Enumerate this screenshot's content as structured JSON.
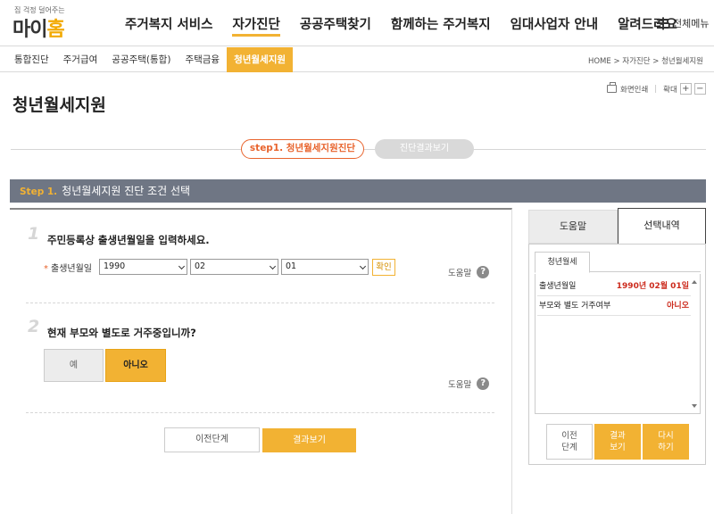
{
  "header": {
    "logo": {
      "tagline": "집 걱정 덜어주는",
      "name_part1": "마이",
      "name_part2": "홈"
    },
    "nav": [
      {
        "label": "주거복지 서비스"
      },
      {
        "label": "자가진단",
        "active": true
      },
      {
        "label": "공공주택찾기"
      },
      {
        "label": "함께하는 주거복지"
      },
      {
        "label": "임대사업자 안내"
      },
      {
        "label": "알려드려요"
      }
    ],
    "all_menu_label": "전체메뉴"
  },
  "subnav": {
    "tabs": [
      {
        "label": "통합진단"
      },
      {
        "label": "주거급여"
      },
      {
        "label": "공공주택(통합)"
      },
      {
        "label": "주택금융"
      },
      {
        "label": "청년월세지원",
        "active": true
      }
    ],
    "breadcrumb": "HOME > 자가진단 > 청년월세지원"
  },
  "page": {
    "title": "청년월세지원",
    "print_label": "화면인쇄",
    "zoom_label": "확대",
    "zoom_in": "+",
    "zoom_out": "−"
  },
  "steps": {
    "step1": "step1. 청년월세지원진단",
    "step2": "진단결과보기"
  },
  "section_bar": {
    "prefix": "Step 1.",
    "title": "청년월세지원 진단 조건 선택"
  },
  "question1": {
    "number": "1",
    "text": "주민등록상 출생년월일을 입력하세요.",
    "field_label": "출생년월일",
    "required_mark": "*",
    "year": "1990",
    "month": "02",
    "day": "01",
    "confirm_label": "확인",
    "help_label": "도움말",
    "help_icon": "?"
  },
  "question2": {
    "number": "2",
    "text": "현재 부모와 별도로 거주중입니까?",
    "yes_label": "예",
    "no_label": "아니오",
    "selected": "아니오",
    "help_label": "도움말",
    "help_icon": "?"
  },
  "actions": {
    "prev_label": "이전단계",
    "result_label": "결과보기"
  },
  "right_panel": {
    "tabs": [
      {
        "label": "도움말"
      },
      {
        "label": "선택내역",
        "active": true
      }
    ],
    "subtab": "청년월세",
    "rows": [
      {
        "key": "출생년월일",
        "value": "1990년 02월 01일"
      },
      {
        "key": "부모와 별도 거주여부",
        "value": "아니오"
      }
    ],
    "buttons": {
      "prev": "이전 단계",
      "result": "결과 보기",
      "again": "다시 하기"
    }
  },
  "colors": {
    "accent": "#f2b233",
    "step_accent": "#e8632c",
    "section_bar": "#6f7684",
    "value_red": "#cc2b1d"
  }
}
